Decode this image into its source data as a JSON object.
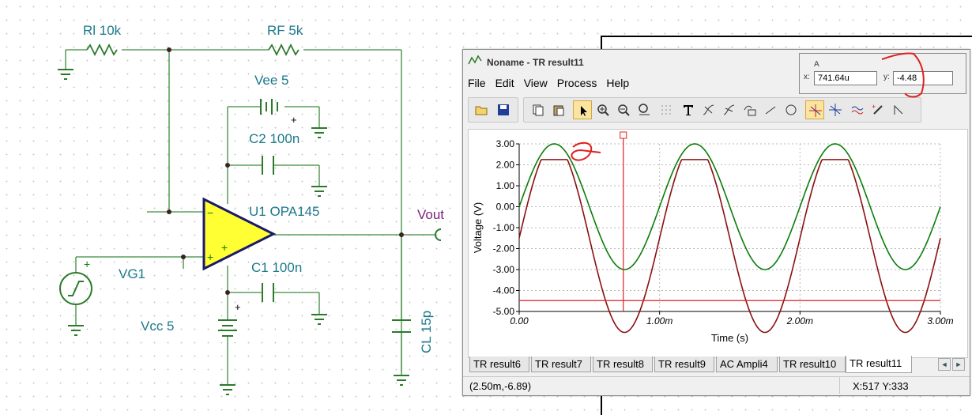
{
  "schematic": {
    "rl_label": "Rl 10k",
    "rf_label": "RF 5k",
    "vee_label": "Vee 5",
    "c2_label": "C2 100n",
    "u1_label": "U1 OPA145",
    "vout_label": "Vout",
    "vg1_label": "VG1",
    "c1_label": "C1 100n",
    "vcc_label": "Vcc 5",
    "cl_label": "CL 15p",
    "minus_sign": "−",
    "plus_sign": "+"
  },
  "window": {
    "title": "Noname - TR result11",
    "menu": [
      "File",
      "Edit",
      "View",
      "Process",
      "Help"
    ]
  },
  "toolbar_icons": [
    "open-icon",
    "save-icon",
    "copy-icon",
    "paste-icon",
    "select-arrow-icon",
    "zoom-in-icon",
    "zoom-out-icon",
    "zoom-100-icon",
    "grid-icon",
    "text-icon",
    "cursor-a-icon",
    "cursor-b-icon",
    "formula-icon",
    "line-icon",
    "circle-icon",
    "marker-icon",
    "marker-b-icon",
    "wave-icon",
    "pen-icon",
    "step-icon"
  ],
  "chart_data": {
    "type": "line",
    "xlabel": "Time (s)",
    "ylabel": "Voltage (V)",
    "xlim": [
      0,
      0.003
    ],
    "ylim": [
      -5,
      3
    ],
    "x_ticks": [
      "0.00",
      "1.00m",
      "2.00m",
      "3.00m"
    ],
    "y_ticks": [
      "3.00",
      "2.00",
      "1.00",
      "0.00",
      "-1.00",
      "-2.00",
      "-3.00",
      "-4.00",
      "-5.00"
    ],
    "series": [
      {
        "color": "#0a7d0a",
        "kind": "sine",
        "amplitude": 3,
        "offset": 0,
        "frequency_hz": 1000
      },
      {
        "color": "#8a1010",
        "kind": "clipped_sine",
        "amplitude": 4.5,
        "offset": -1.5,
        "frequency_hz": 1000,
        "clip_high": 2.25
      }
    ],
    "cursor_x": 0.00074164,
    "cursor_y": -4.48,
    "grid": true
  },
  "tabs": [
    "TR result6",
    "TR result7",
    "TR result8",
    "TR result9",
    "AC Ampli4",
    "TR result10",
    "TR result11"
  ],
  "selected_tab": "TR result11",
  "status": {
    "left": "(2.50m,-6.89)",
    "right": "X:517  Y:333"
  },
  "coord_box": {
    "label": "A",
    "x_label": "x:",
    "x_value": "741.64u",
    "y_label": "y:",
    "y_value": "-4.48"
  },
  "colors": {
    "schematic_wire": "#3c8a3c",
    "label_teal": "#1b7a8a",
    "vout_purple": "#7a1f7a",
    "opamp_fill": "#ffff33",
    "cursor_red": "#e02020",
    "annotation_red": "#e02020"
  }
}
